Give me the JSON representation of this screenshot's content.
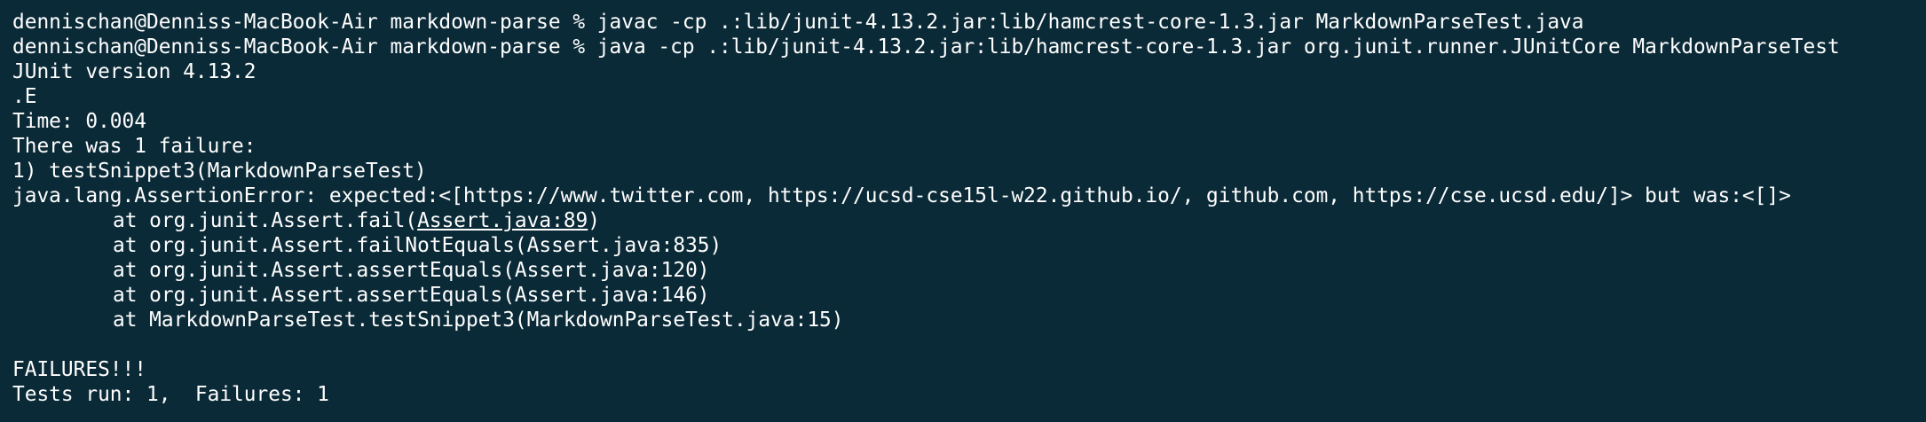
{
  "terminal": {
    "lines": [
      {
        "text": "dennischan@Denniss-MacBook-Air markdown-parse % javac -cp .:lib/junit-4.13.2.jar:lib/hamcrest-core-1.3.jar MarkdownParseTest.java"
      },
      {
        "text": "dennischan@Denniss-MacBook-Air markdown-parse % java -cp .:lib/junit-4.13.2.jar:lib/hamcrest-core-1.3.jar org.junit.runner.JUnitCore MarkdownParseTest"
      },
      {
        "text": "JUnit version 4.13.2"
      },
      {
        "text": ".E"
      },
      {
        "text": "Time: 0.004"
      },
      {
        "text": "There was 1 failure:"
      },
      {
        "text": "1) testSnippet3(MarkdownParseTest)"
      },
      {
        "text": "java.lang.AssertionError: expected:<[https://www.twitter.com, https://ucsd-cse15l-w22.github.io/, github.com, https://cse.ucsd.edu/]> but was:<[]>"
      },
      {
        "prefix": "at org.junit.Assert.fail(",
        "link": "Assert.java:89",
        "suffix": ")"
      },
      {
        "text": "at org.junit.Assert.failNotEquals(Assert.java:835)"
      },
      {
        "text": "at org.junit.Assert.assertEquals(Assert.java:120)"
      },
      {
        "text": "at org.junit.Assert.assertEquals(Assert.java:146)"
      },
      {
        "text": "at MarkdownParseTest.testSnippet3(MarkdownParseTest.java:15)"
      },
      {
        "text": ""
      },
      {
        "text": "FAILURES!!!"
      },
      {
        "text": "Tests run: 1,  Failures: 1"
      }
    ]
  },
  "colors": {
    "background": "#0b2a37",
    "foreground": "#ffffff"
  }
}
